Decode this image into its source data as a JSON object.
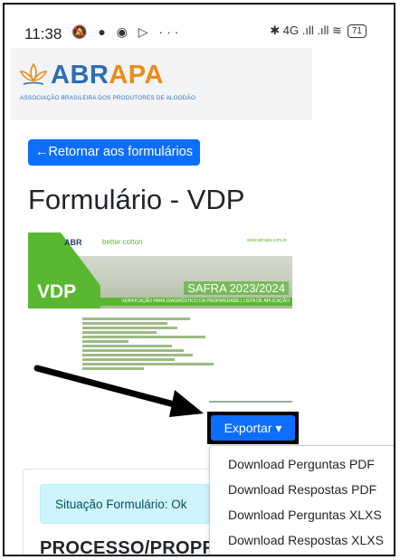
{
  "status": {
    "time": "11:38",
    "battery": "71",
    "network": "4G",
    "left_icons": "🔕 ● ◉ ▷ ···",
    "right_icons": "✱ 4G .ıll .ıll ≋"
  },
  "header": {
    "logo_part1": "ABR",
    "logo_part2": "APA",
    "tagline": "ASSOCIAÇÃO BRASILEIRA DOS PRODUTORES DE ALGODÃO"
  },
  "nav": {
    "back_label": "←Retornar aos formulários"
  },
  "page": {
    "title": "Formulário - VDP"
  },
  "thumbnail": {
    "abr": "ABR",
    "better_cotton": "better cotton",
    "url": "www.abrapa.com.br",
    "vdp": "VDP",
    "safra": "SAFRA 2023/2024",
    "band": "VERIFICAÇÃO PARA DIAGNÓSTICO DA PROPRIEDADE | LISTA DE APLICAÇÃO"
  },
  "export": {
    "label": "Exportar",
    "caret": "▾",
    "menu": [
      "Download Perguntas PDF",
      "Download Respostas PDF",
      "Download Perguntas XLXS",
      "Download Respostas XLXS"
    ]
  },
  "form": {
    "status_text": "Situação Formulário: Ok",
    "section_title": "PROCESSO/PROPRI"
  },
  "colors": {
    "primary": "#0d6efd",
    "brand_blue": "#2f6db5",
    "brand_orange": "#ea8c1a",
    "green": "#5ab830"
  }
}
